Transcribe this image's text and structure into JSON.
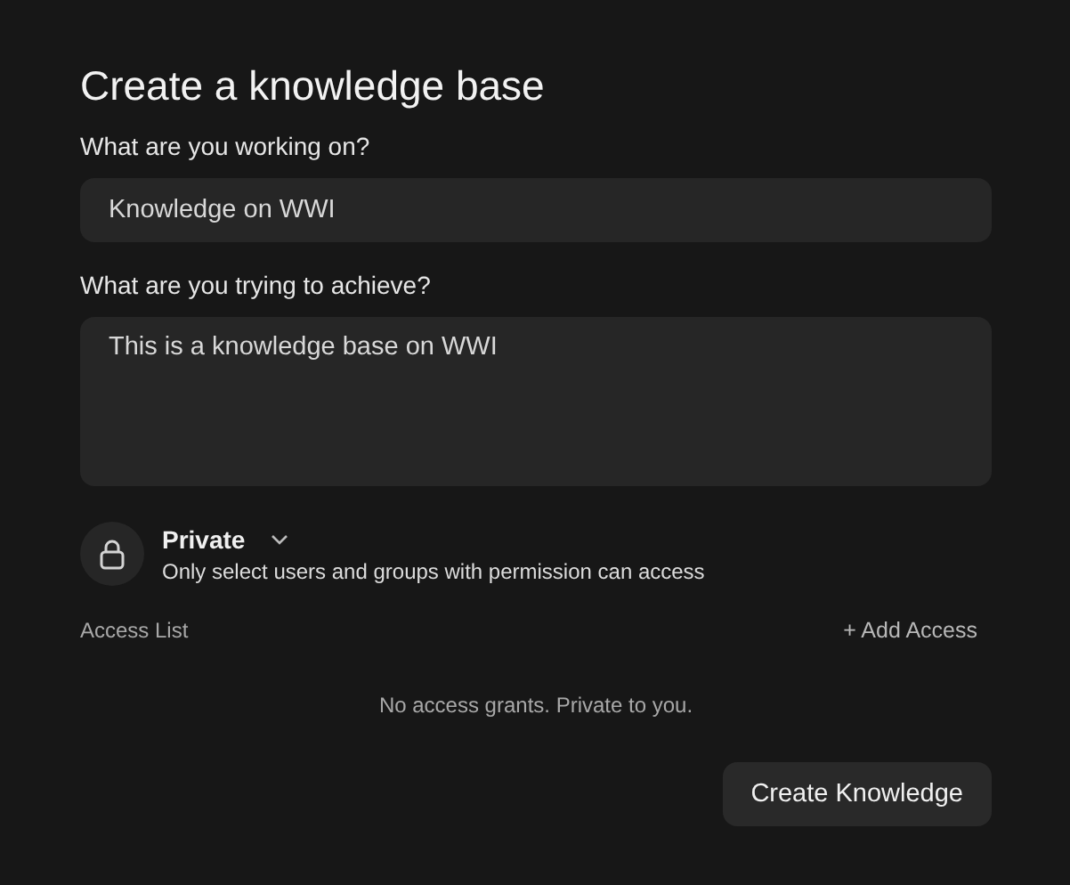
{
  "title": "Create a knowledge base",
  "fields": [
    {
      "kind": "input",
      "label": "What are you working on?",
      "value": "Knowledge on WWI"
    },
    {
      "kind": "textarea",
      "label": "What are you trying to achieve?",
      "value": "This is a knowledge base on WWI"
    }
  ],
  "visibility": {
    "label": "Private",
    "description": "Only select users and groups with permission can access"
  },
  "access": {
    "label": "Access List",
    "add_button": "+ Add Access",
    "empty_text": "No access grants. Private to you."
  },
  "submit_button": "Create Knowledge"
}
